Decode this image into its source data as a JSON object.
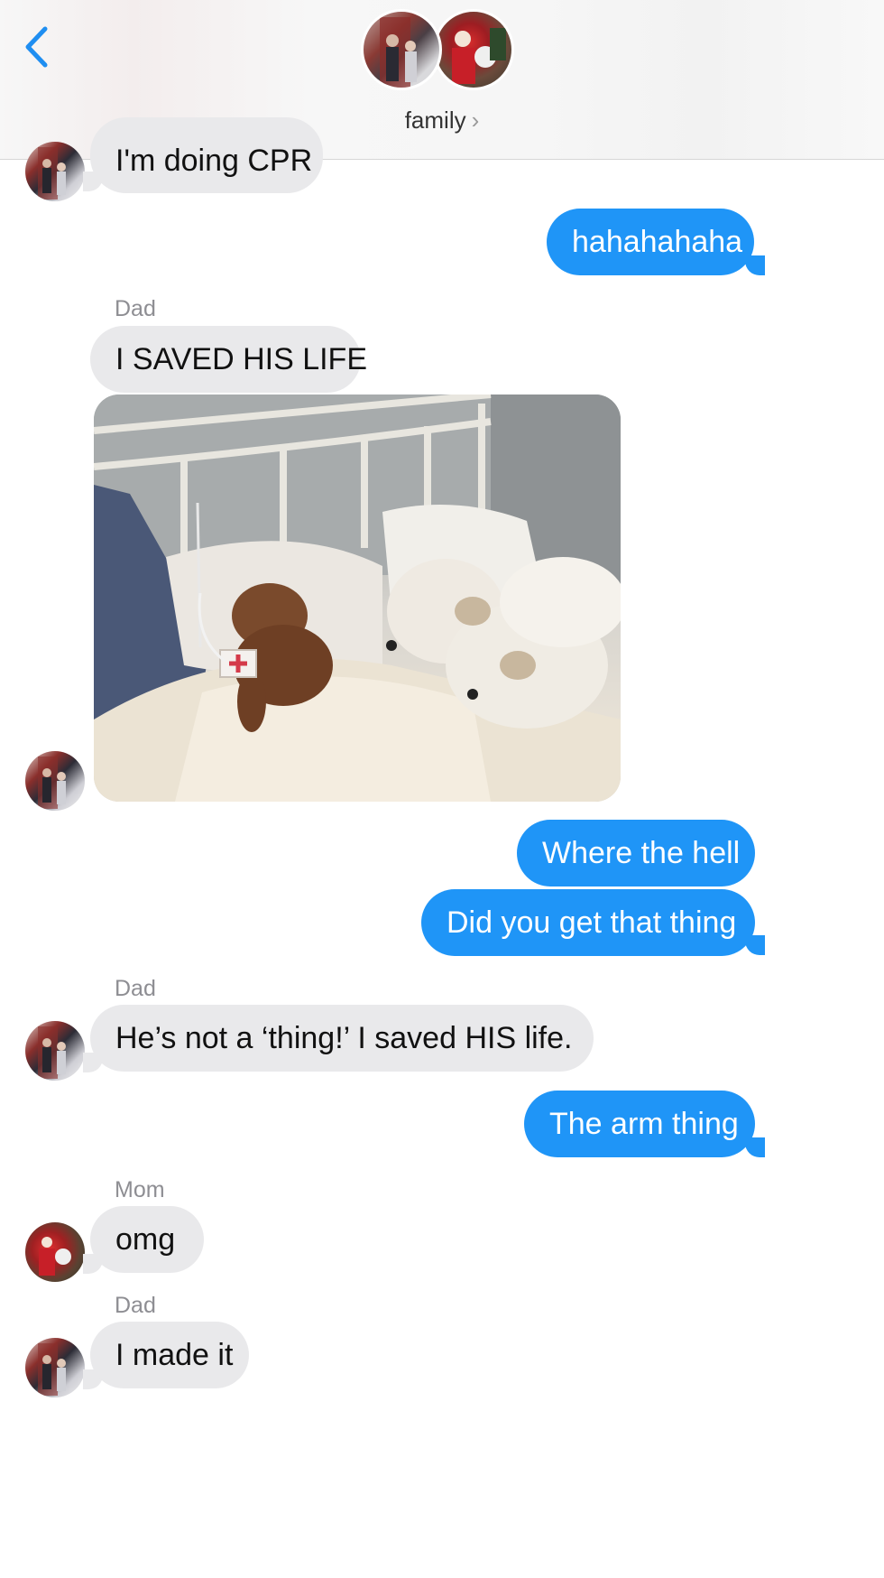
{
  "header": {
    "back_label": "back",
    "group_name": "family",
    "chevron": "›",
    "icons": [
      "chevron-left-icon",
      "chevron-right-icon"
    ]
  },
  "colors": {
    "incoming_bubble": "#e9e9eb",
    "outgoing_bubble": "#1f95f7",
    "accent": "#1f8ef1",
    "sender_label": "#8e8e93"
  },
  "messages": [
    {
      "direction": "in",
      "sender": "",
      "text": "I'm doing CPR"
    },
    {
      "direction": "out",
      "text": "hahahahaha"
    },
    {
      "direction": "in",
      "sender": "Dad",
      "text": "I SAVED HIS LIFE"
    },
    {
      "direction": "in",
      "sender": "",
      "type": "photo",
      "description_icon": "photo-attachment"
    },
    {
      "direction": "out",
      "text": "Where the hell"
    },
    {
      "direction": "out",
      "text": "Did you get that thing"
    },
    {
      "direction": "in",
      "sender": "Dad",
      "text": "He’s not a ‘thing!’  I saved HIS life."
    },
    {
      "direction": "out",
      "text": "The arm thing"
    },
    {
      "direction": "in",
      "sender": "Mom",
      "text": "omg"
    },
    {
      "direction": "in",
      "sender": "Dad",
      "text": "I made it"
    }
  ]
}
